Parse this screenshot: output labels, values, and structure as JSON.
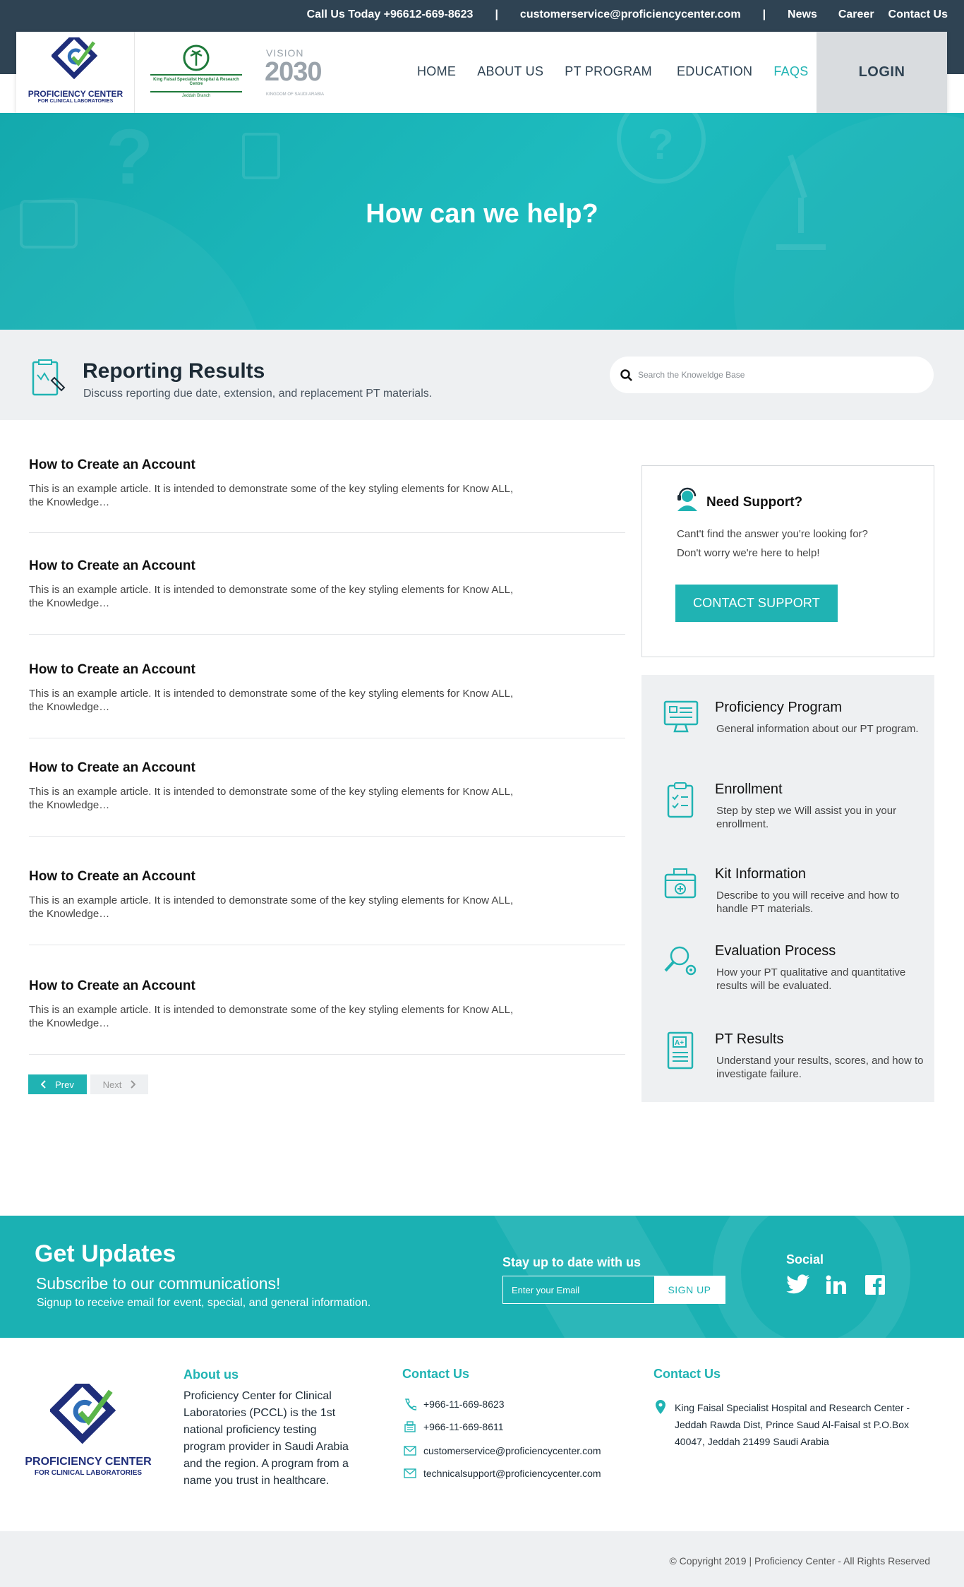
{
  "topbar": {
    "call_label": "Call Us Today  +96612-669-8623",
    "sep1": "|",
    "email": "customerservice@proficiencycenter.com",
    "sep2": "|",
    "links": [
      "News",
      "Career",
      "Contact Us"
    ]
  },
  "header": {
    "logo_line1": "PROFICIENCY CENTER",
    "logo_line2": "FOR CLINICAL LABORATORIES",
    "partner_logo_text": "King Faisal Specialist Hospital & Research Centre",
    "partner_sub": "Jeddah Branch",
    "vision_top": "VISION",
    "vision_year": "2030",
    "vision_sub": "KINGDOM OF SAUDI ARABIA",
    "nav": [
      "HOME",
      "ABOUT US",
      "PT PROGRAM",
      "EDUCATION",
      "FAQS"
    ],
    "active_nav": "FAQS",
    "login": "LOGIN"
  },
  "hero": {
    "title": "How can we help?"
  },
  "category_header": {
    "title": "Reporting Results",
    "description": "Discuss reporting due date, extension, and replacement PT materials.",
    "search_placeholder": "Search the Knoweldge Base"
  },
  "articles": [
    {
      "title": "How to Create an Account",
      "excerpt": "This is an example article. It is intended to demonstrate some of the key styling elements for Know ALL, the Knowledge…"
    },
    {
      "title": "How to Create an Account",
      "excerpt": "This is an example article. It is intended to demonstrate some of the key styling elements for Know ALL, the Knowledge…"
    },
    {
      "title": "How to Create an Account",
      "excerpt": "This is an example article. It is intended to demonstrate some of the key styling elements for Know ALL, the Knowledge…"
    },
    {
      "title": "How to Create an Account",
      "excerpt": "This is an example article. It is intended to demonstrate some of the key styling elements for Know ALL, the Knowledge…"
    },
    {
      "title": "How to Create an Account",
      "excerpt": "This is an example article. It is intended to demonstrate some of the key styling elements for Know ALL, the Knowledge…"
    },
    {
      "title": "How to Create an Account",
      "excerpt": "This is an example article. It is intended to demonstrate some of the key styling elements for Know ALL, the Knowledge…"
    }
  ],
  "pagination": {
    "prev": "Prev",
    "next": "Next"
  },
  "support": {
    "title": "Need Support?",
    "line1": "Cant't find the answer you're looking for?",
    "line2": "Don't worry we're here to help!",
    "button": "CONTACT SUPPORT"
  },
  "categories": [
    {
      "title": "Proficiency Program",
      "desc": "General information about our PT program.",
      "icon": "monitor-icon"
    },
    {
      "title": "Enrollment",
      "desc": "Step by step we Will assist you in your enrollment.",
      "icon": "clipboard-checklist-icon"
    },
    {
      "title": "Kit Information",
      "desc": "Describe to you will receive and how to handle PT materials.",
      "icon": "kit-box-icon"
    },
    {
      "title": "Evaluation Process",
      "desc": "How your PT qualitative and quantitative results will be evaluated.",
      "icon": "magnifier-gear-icon"
    },
    {
      "title": "PT Results",
      "desc": "Understand your results, scores, and how to investigate failure.",
      "icon": "grade-document-icon"
    }
  ],
  "updates": {
    "title": "Get Updates",
    "subtitle": "Subscribe to our communications!",
    "text": "Signup to receive email for event, special, and general information.",
    "stay_label": "Stay up to date with us",
    "email_placeholder": "Enter your Email",
    "signup": "SIGN UP",
    "social_label": "Social"
  },
  "footer": {
    "logo_line1": "PROFICIENCY CENTER",
    "logo_line2": "FOR CLINICAL LABORATORIES",
    "about_heading": "About us",
    "about_text": "Proficiency Center for Clinical Laboratories (PCCL) is the 1st national proficiency testing program provider in Saudi Arabia and the region. A program from a name you trust in healthcare.",
    "contact_heading": "Contact Us",
    "phone": "+966-11-669-8623",
    "fax": "+966-11-669-8611",
    "email1": "customerservice@proficiencycenter.com",
    "email2": "technicalsupport@proficiencycenter.com",
    "address_heading": "Contact Us",
    "address": "King Faisal Specialist Hospital and Research Center - Jeddah Rawda Dist, Prince Saud Al-Faisal st  P.O.Box 40047, Jeddah 21499 Saudi Arabia"
  },
  "copyright": "© Copyright  2019  |  Proficiency Center - All Rights Reserved",
  "colors": {
    "accent": "#20b3b3",
    "dark": "#2f4353",
    "panel": "#eef0f2"
  }
}
